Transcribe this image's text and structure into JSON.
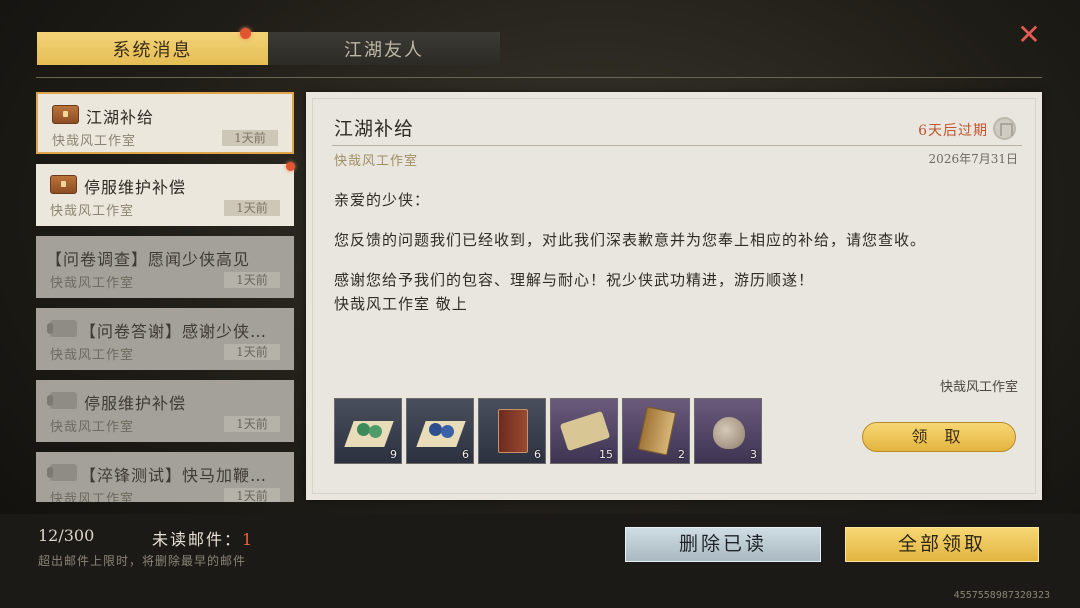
{
  "tabs": {
    "system": "系统消息",
    "friends": "江湖友人"
  },
  "mails": [
    {
      "title": "江湖补给",
      "sender": "快哉风工作室",
      "time": "1天前",
      "state": "selected"
    },
    {
      "title": "停服维护补偿",
      "sender": "快哉风工作室",
      "time": "1天前",
      "state": "unread"
    },
    {
      "title": "【问卷调查】愿闻少侠高见",
      "sender": "快哉风工作室",
      "time": "1天前",
      "state": "read"
    },
    {
      "title": "【问卷答谢】感谢少侠…",
      "sender": "快哉风工作室",
      "time": "1天前",
      "state": "read"
    },
    {
      "title": "停服维护补偿",
      "sender": "快哉风工作室",
      "time": "1天前",
      "state": "read"
    },
    {
      "title": "【淬锋测试】快马加鞭…",
      "sender": "快哉风工作室",
      "time": "1天前",
      "state": "read"
    }
  ],
  "letter": {
    "title": "江湖补给",
    "expire": "6天后过期",
    "from": "快哉风工作室",
    "date": "2026年7月31日",
    "greeting": "亲爱的少侠：",
    "para1": "您反馈的问题我们已经收到，对此我们深表歉意并为您奉上相应的补给，请您查收。",
    "para2": "感谢您给予我们的包容、理解与耐心！祝少侠武功精进，游历顺遂！",
    "para3": "快哉风工作室 敬上",
    "signature": "快哉风工作室",
    "claim_label": "领 取"
  },
  "rewards": [
    {
      "icon": "pill-packet-icon",
      "count": "9"
    },
    {
      "icon": "pill-packet-icon",
      "count": "6"
    },
    {
      "icon": "martial-book-icon",
      "count": "6"
    },
    {
      "icon": "scroll-icon",
      "count": "15"
    },
    {
      "icon": "manual-book-icon",
      "count": "2"
    },
    {
      "icon": "pouch-icon",
      "count": "3"
    }
  ],
  "footer": {
    "mail_count": "12/300",
    "unread_label": "未读邮件：",
    "unread_count": "1",
    "limit_tip": "超出邮件上限时，将删除最早的邮件",
    "delete_read": "删除已读",
    "claim_all": "全部领取",
    "uid": "4557558987320323"
  },
  "colors": {
    "accent_gold": "#e9c25c",
    "expire_red": "#c0552d",
    "unread_dot": "#e2562f"
  }
}
